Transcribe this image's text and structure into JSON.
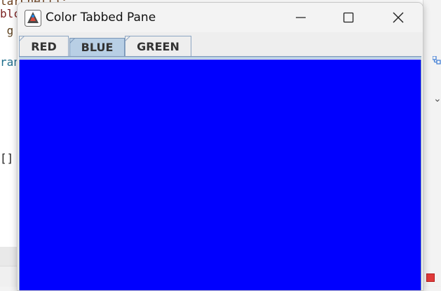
{
  "background": {
    "code_lines": [
      "tarChell);",
      "blc",
      " g",
      "ran",
      "[]"
    ]
  },
  "window": {
    "title": "Color Tabbed Pane",
    "controls": {
      "minimize_icon": "minimize-icon",
      "maximize_icon": "maximize-icon",
      "close_icon": "close-icon"
    }
  },
  "tabs": [
    {
      "label": "RED",
      "selected": false
    },
    {
      "label": "BLUE",
      "selected": true
    },
    {
      "label": "GREEN",
      "selected": false
    }
  ],
  "content": {
    "color": "#0000ff"
  },
  "colors": {
    "selected_tab": "#b8cfe5",
    "tab_border": "#8da6c3",
    "panel_fill": "#0000ff"
  }
}
